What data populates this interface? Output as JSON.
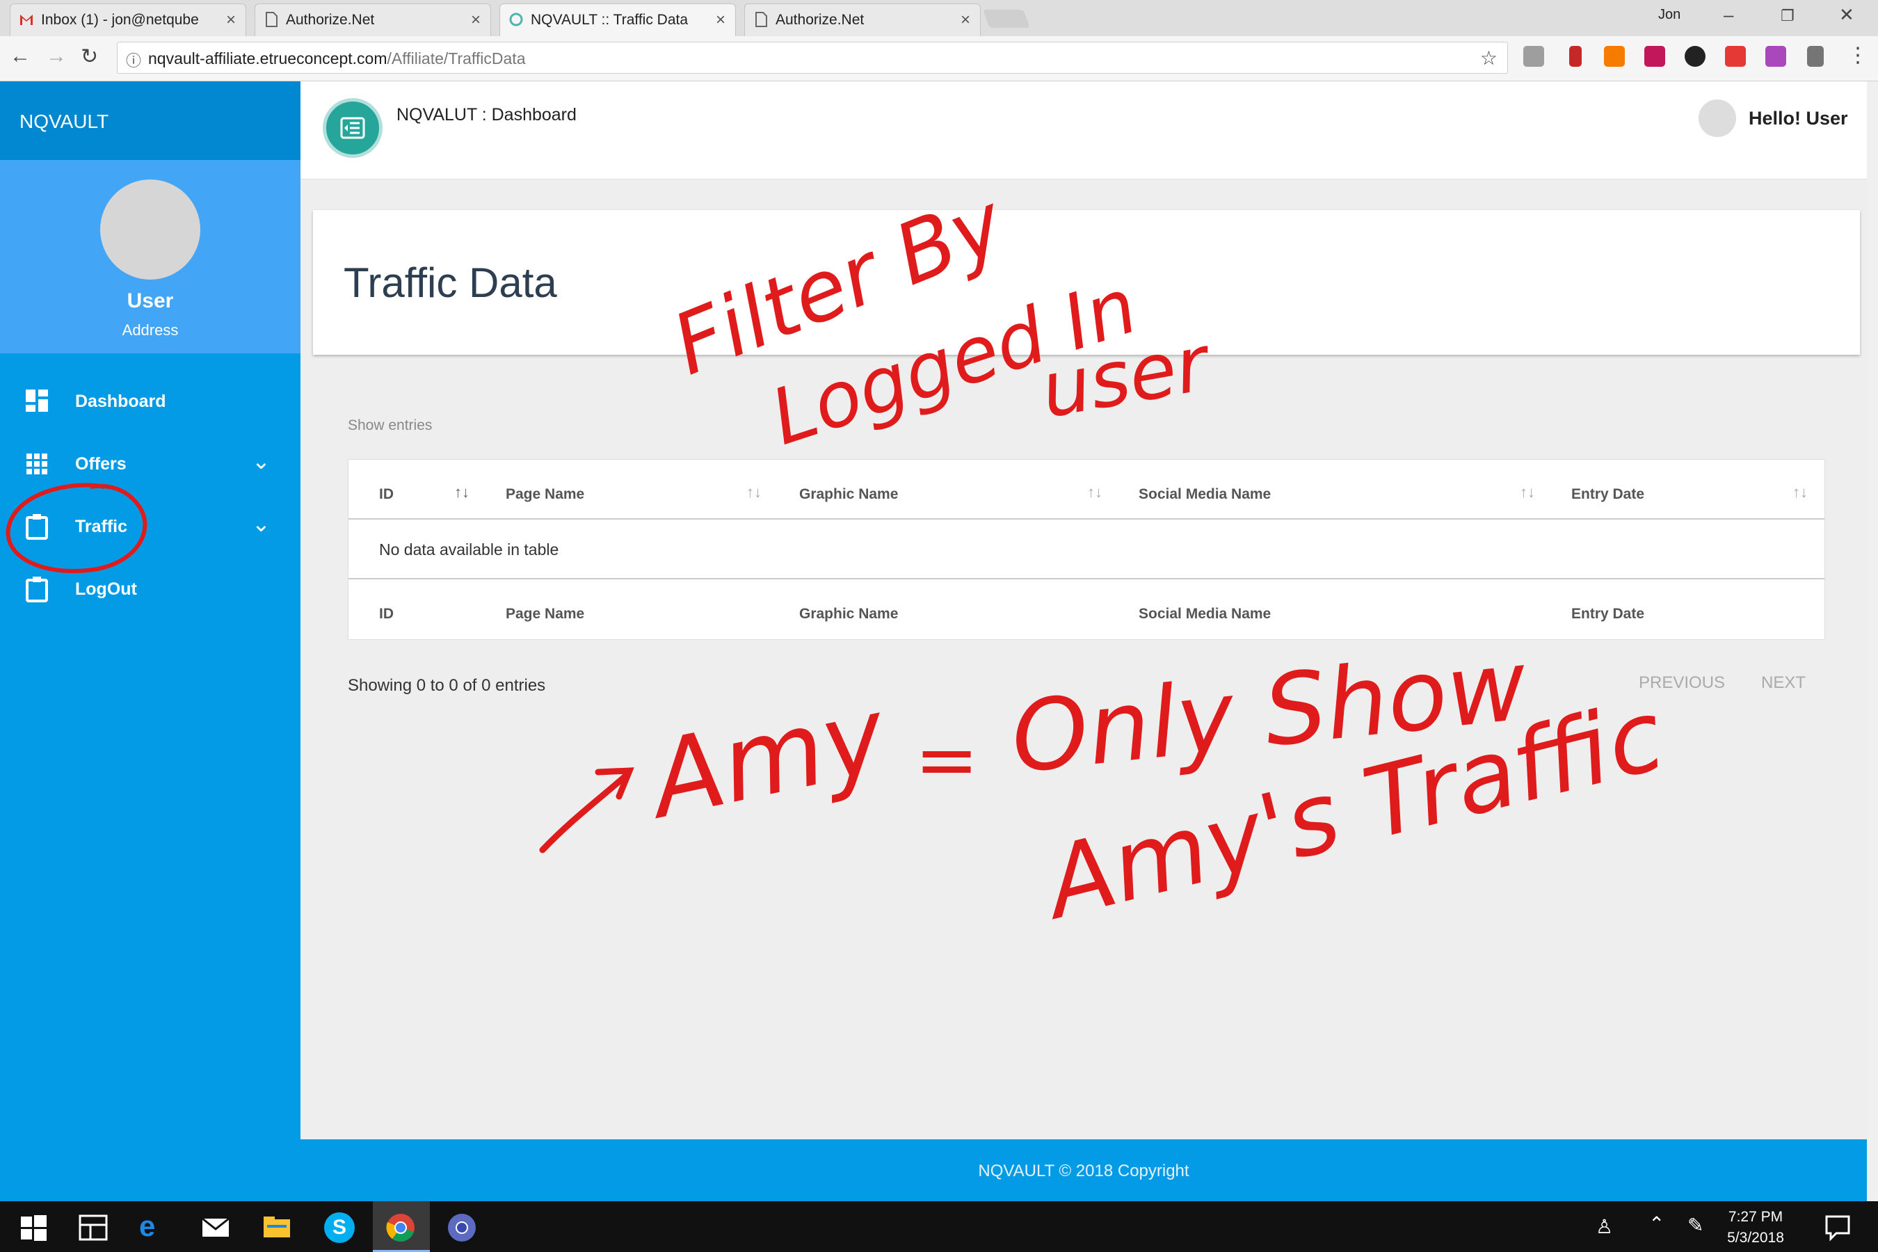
{
  "browser": {
    "tabs": [
      {
        "label": "Inbox (1) - jon@netqube",
        "icon": "gmail-icon"
      },
      {
        "label": "Authorize.Net",
        "icon": "page-icon"
      },
      {
        "label": "NQVAULT :: Traffic Data",
        "icon": "site-icon"
      },
      {
        "label": "Authorize.Net",
        "icon": "page-icon"
      }
    ],
    "profile_name": "Jon",
    "url_host": "nqvault-affiliate.etrueconcept.com",
    "url_path": "/Affiliate/TrafficData"
  },
  "sidebar": {
    "brand": "NQVAULT",
    "user_name": "User",
    "user_address": "Address",
    "items": [
      {
        "label": "Dashboard",
        "icon": "dashboard-icon"
      },
      {
        "label": "Offers",
        "icon": "grid-icon"
      },
      {
        "label": "Traffic",
        "icon": "clipboard-icon"
      },
      {
        "label": "LogOut",
        "icon": "clipboard-icon"
      }
    ]
  },
  "header": {
    "breadcrumb": "NQVALUT : Dashboard",
    "greeting": "Hello! User"
  },
  "page": {
    "title": "Traffic Data",
    "show_entries": "Show entries",
    "columns": [
      "ID",
      "Page Name",
      "Graphic Name",
      "Social Media Name",
      "Entry Date"
    ],
    "empty_message": "No data available in table",
    "summary": "Showing 0 to 0 of 0 entries",
    "prev_label": "PREVIOUS",
    "next_label": "NEXT"
  },
  "footer": {
    "copyright": "NQVAULT © 2018 Copyright"
  },
  "taskbar": {
    "time": "7:27 PM",
    "date": "5/3/2018"
  },
  "annotations": {
    "top_note_line1": "Filter By",
    "top_note_line2": "Logged In",
    "top_note_line3": "user",
    "bottom_note_left": "Amy",
    "bottom_note_eq": "=",
    "bottom_note_right1": "Only Show",
    "bottom_note_right2": "Amy's Traffic",
    "ink_color": "#e01b1b"
  },
  "colors": {
    "sidebar": "#039be5",
    "brand_bar": "#0288d1",
    "user_panel": "#42a5f5",
    "accent_teal": "#26a69a"
  }
}
